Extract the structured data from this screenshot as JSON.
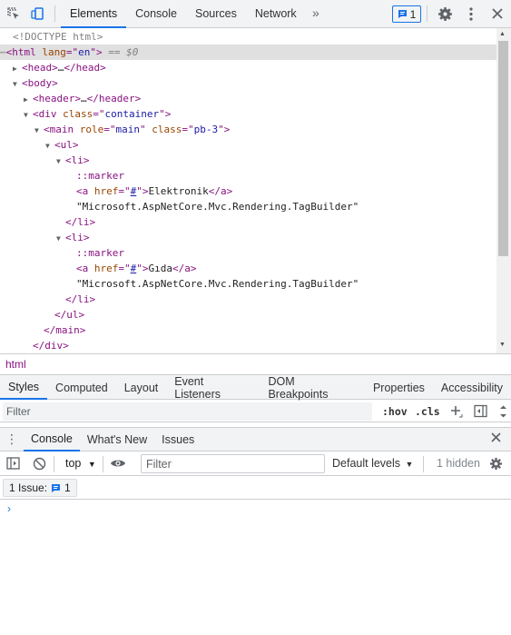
{
  "toolbar": {
    "tabs": [
      "Elements",
      "Console",
      "Sources",
      "Network"
    ],
    "more": "»",
    "issue_count": "1"
  },
  "dom": {
    "doctype": "<!DOCTYPE html>",
    "html_lang": "en",
    "selected_marker": "== $0",
    "head": "<head>…</head>",
    "header": "<header>…</header>",
    "container_class": "container",
    "main_role": "main",
    "main_class": "pb-3",
    "items": [
      {
        "href": "#",
        "text": "Elektronik",
        "tagbuilder": "\"Microsoft.AspNetCore.Mvc.Rendering.TagBuilder\""
      },
      {
        "href": "#",
        "text": "Gıda",
        "tagbuilder": "\"Microsoft.AspNetCore.Mvc.Rendering.TagBuilder\""
      }
    ],
    "marker": "::marker"
  },
  "breadcrumb": "html",
  "styles_tabs": [
    "Styles",
    "Computed",
    "Layout",
    "Event Listeners",
    "DOM Breakpoints",
    "Properties",
    "Accessibility"
  ],
  "styles_filter_placeholder": "Filter",
  "hov": ":hov",
  "cls": ".cls",
  "drawer": {
    "tabs": [
      "Console",
      "What's New",
      "Issues"
    ],
    "context": "top",
    "filter_placeholder": "Filter",
    "levels": "Default levels",
    "hidden": "1 hidden",
    "issues_label": "1 Issue:",
    "issues_count": "1",
    "prompt": "›"
  },
  "colors": {
    "accent": "#1a73e8",
    "tag": "#881280",
    "attr": "#994500",
    "value": "#1a1aa6"
  }
}
